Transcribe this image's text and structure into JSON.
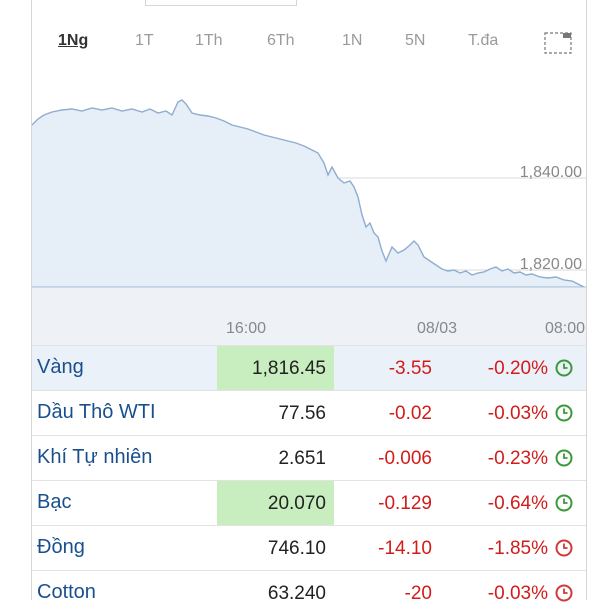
{
  "ranges": [
    "1Ng",
    "1T",
    "1Th",
    "6Th",
    "1N",
    "5N",
    "T.đa"
  ],
  "active_range": "1Ng",
  "chart": {
    "y_ticks": [
      "1,840.00",
      "1,820.00"
    ],
    "x_ticks": [
      "16:00",
      "08/03",
      "08:00"
    ],
    "line_color": "#8eadd0",
    "fill_color": "#e6eef7"
  },
  "rows": [
    {
      "name": "Vàng",
      "price": "1,816.45",
      "change": "-3.55",
      "pct": "-0.20%",
      "highlight": true,
      "status": "green"
    },
    {
      "name": "Dầu Thô WTI",
      "price": "77.56",
      "change": "-0.02",
      "pct": "-0.03%",
      "highlight": false,
      "status": "green"
    },
    {
      "name": "Khí Tự nhiên",
      "price": "2.651",
      "change": "-0.006",
      "pct": "-0.23%",
      "highlight": false,
      "status": "green"
    },
    {
      "name": "Bạc",
      "price": "20.070",
      "change": "-0.129",
      "pct": "-0.64%",
      "highlight": true,
      "status": "green"
    },
    {
      "name": "Đồng",
      "price": "746.10",
      "change": "-14.10",
      "pct": "-1.85%",
      "highlight": false,
      "status": "red"
    },
    {
      "name": "Cotton",
      "price": "63.240",
      "change": "-20",
      "pct": "-0.03%",
      "highlight": false,
      "status": "red"
    }
  ],
  "colors": {
    "negative": "#d21b1b",
    "status_green": "#3a9a3a",
    "status_red": "#d03a3a",
    "name_link": "#1a4f8e"
  }
}
